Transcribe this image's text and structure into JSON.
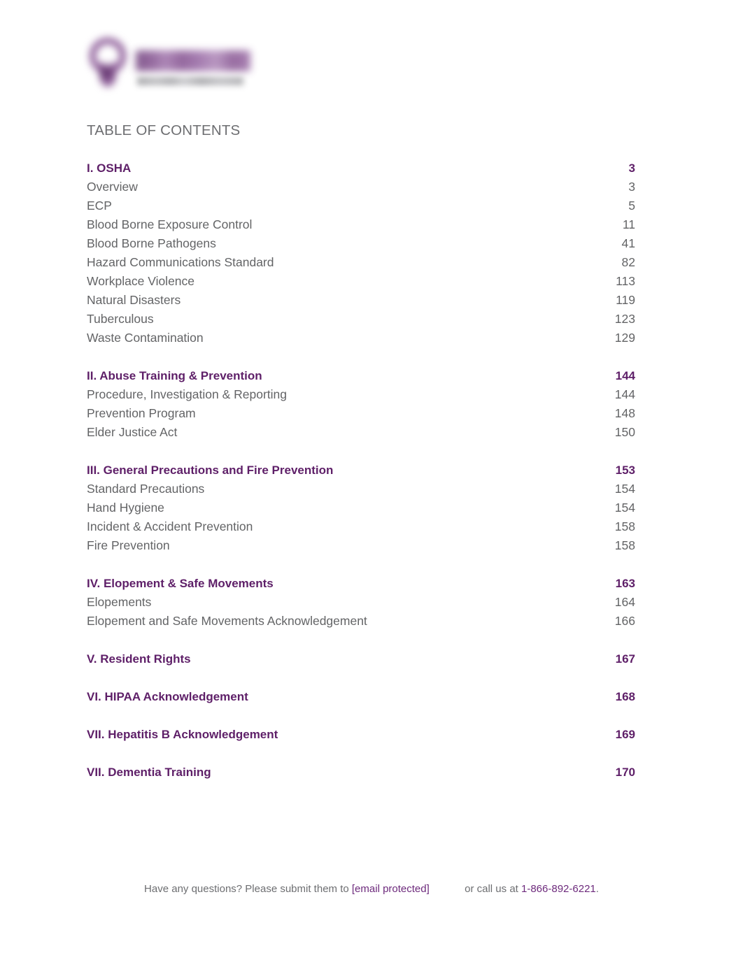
{
  "document": {
    "title": "TABLE OF CONTENTS"
  },
  "logo": {
    "mark": "water-drop-logo-mark",
    "wordmark": "blurred-brand-wordmark",
    "tagline": "blurred-brand-tagline"
  },
  "toc": {
    "groups": [
      {
        "section": {
          "label": "I. OSHA",
          "page": "3"
        },
        "items": [
          {
            "label": "Overview",
            "page": "3"
          },
          {
            "label": "ECP",
            "page": "5"
          },
          {
            "label": "Blood Borne Exposure Control",
            "page": "11"
          },
          {
            "label": "Blood Borne Pathogens",
            "page": "41"
          },
          {
            "label": "Hazard Communications Standard",
            "page": "82"
          },
          {
            "label": "Workplace Violence",
            "page": "113"
          },
          {
            "label": "Natural Disasters",
            "page": "119"
          },
          {
            "label": "Tuberculous",
            "page": "123"
          },
          {
            "label": "Waste Contamination",
            "page": "129"
          }
        ]
      },
      {
        "section": {
          "label": "II. Abuse Training & Prevention",
          "page": "144"
        },
        "items": [
          {
            "label": "Procedure, Investigation & Reporting",
            "page": "144"
          },
          {
            "label": "Prevention Program",
            "page": "148"
          },
          {
            "label": "Elder Justice Act",
            "page": "150"
          }
        ]
      },
      {
        "section": {
          "label": "III. General Precautions and Fire Prevention",
          "page": "153"
        },
        "items": [
          {
            "label": "Standard Precautions",
            "page": "154"
          },
          {
            "label": "Hand Hygiene",
            "page": "154"
          },
          {
            "label": "Incident & Accident Prevention",
            "page": "158"
          },
          {
            "label": "Fire Prevention",
            "page": "158"
          }
        ]
      },
      {
        "section": {
          "label": "IV. Elopement & Safe Movements",
          "page": "163"
        },
        "items": [
          {
            "label": "Elopements",
            "page": "164"
          },
          {
            "label": "Elopement and Safe Movements Acknowledgement",
            "page": "166"
          }
        ]
      },
      {
        "section": {
          "label": "V. Resident Rights",
          "page": "167"
        },
        "items": []
      },
      {
        "section": {
          "label": "VI. HIPAA Acknowledgement",
          "page": "168"
        },
        "items": []
      },
      {
        "section": {
          "label": "VII. Hepatitis B Acknowledgement",
          "page": "169"
        },
        "items": []
      },
      {
        "section": {
          "label": "VII. Dementia Training",
          "page": "170"
        },
        "items": []
      }
    ]
  },
  "footer": {
    "lead": "Have any questions? Please submit them to",
    "email": "[email protected]",
    "middle": "or call us at",
    "phone": "1-866-892-6221",
    "period": "."
  }
}
